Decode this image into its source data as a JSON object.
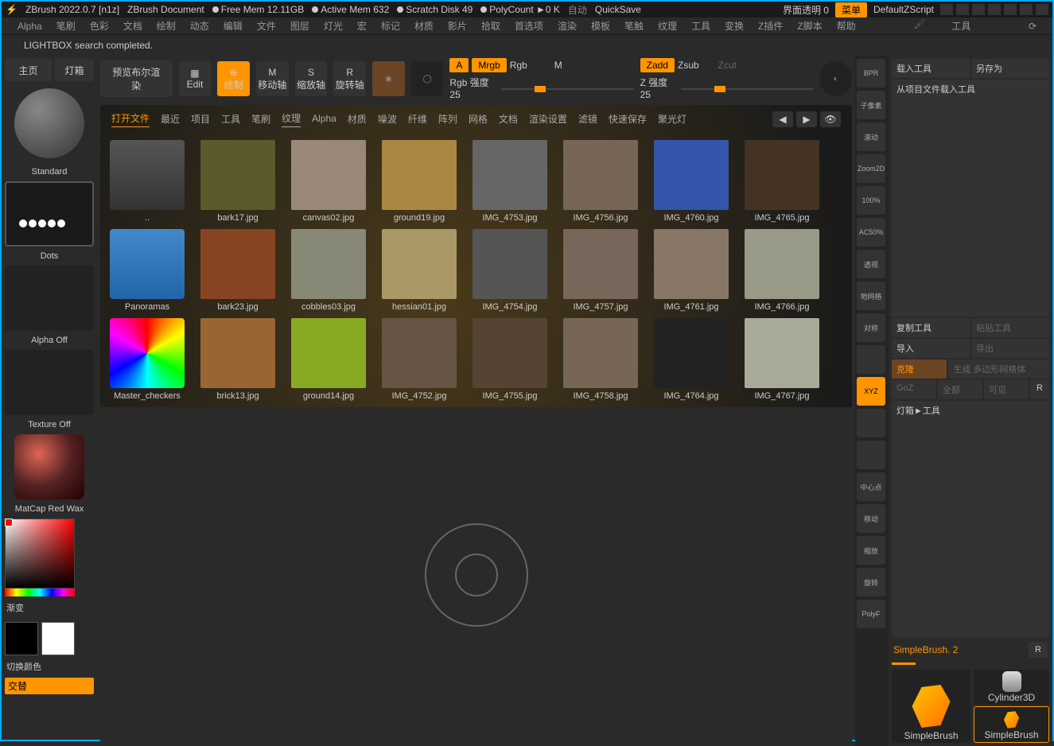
{
  "titlebar": {
    "app": "ZBrush 2022.0.7 [n1z]",
    "doc": "ZBrush Document",
    "mem": "Free Mem 12.11GB",
    "active": "Active Mem 632",
    "scratch": "Scratch Disk 49",
    "poly": "PolyCount ►0 K",
    "auto": "自动",
    "quicksave": "QuickSave",
    "transparency": "界面透明 0",
    "menu": "菜单",
    "script": "DefaultZScript"
  },
  "menu": [
    "Alpha",
    "笔刷",
    "色彩",
    "文档",
    "绘制",
    "动态",
    "编辑",
    "文件",
    "图层",
    "灯光",
    "宏",
    "标记",
    "材质",
    "影片",
    "拾取",
    "首选项",
    "渲染",
    "模板",
    "笔触",
    "纹理",
    "工具",
    "变换",
    "Z插件",
    "Z脚本",
    "帮助"
  ],
  "status": "LIGHTBOX search completed.",
  "left": {
    "home": "主页",
    "lightbox": "灯箱",
    "preview": "预览布尔渲染",
    "standard": "Standard",
    "dots": "Dots",
    "alpha": "Alpha Off",
    "texture": "Texture Off",
    "matcap": "MatCap Red Wax",
    "gradient": "渐变",
    "switch": "切换颜色",
    "alt": "交替"
  },
  "toolbar": {
    "edit": "Edit",
    "draw": "绘制",
    "move": "移动轴",
    "scale": "缩放轴",
    "rotate": "旋转轴",
    "a": "A",
    "mrgb": "Mrgb",
    "rgb": "Rgb",
    "m": "M",
    "zadd": "Zadd",
    "zsub": "Zsub",
    "zcut": "Zcut",
    "rgbint": "Rgb 强度 25",
    "zint": "Z 强度 25"
  },
  "lightbox": {
    "tabs": [
      "打开文件",
      "最近",
      "项目",
      "工具",
      "笔刷",
      "纹理",
      "Alpha",
      "材质",
      "噪波",
      "纤维",
      "阵列",
      "网格",
      "文档",
      "渲染设置",
      "滤镜",
      "快速保存",
      "聚光灯"
    ],
    "active": "纹理",
    "open_active": "打开文件",
    "items": [
      {
        "name": ".."
      },
      {
        "name": "bark17.jpg"
      },
      {
        "name": "canvas02.jpg"
      },
      {
        "name": "ground19.jpg"
      },
      {
        "name": "IMG_4753.jpg"
      },
      {
        "name": "IMG_4756.jpg"
      },
      {
        "name": "IMG_4760.jpg"
      },
      {
        "name": "IMG_4765.jpg"
      },
      {
        "name": "Panoramas"
      },
      {
        "name": "bark23.jpg"
      },
      {
        "name": "cobbles03.jpg"
      },
      {
        "name": "hessian01.jpg"
      },
      {
        "name": "IMG_4754.jpg"
      },
      {
        "name": "IMG_4757.jpg"
      },
      {
        "name": "IMG_4761.jpg"
      },
      {
        "name": "IMG_4766.jpg"
      },
      {
        "name": "Master_checkers"
      },
      {
        "name": "brick13.jpg"
      },
      {
        "name": "ground14.jpg"
      },
      {
        "name": "IMG_4752.jpg"
      },
      {
        "name": "IMG_4755.jpg"
      },
      {
        "name": "IMG_4758.jpg"
      },
      {
        "name": "IMG_4764.jpg"
      },
      {
        "name": "IMG_4767.jpg"
      }
    ]
  },
  "right_tools": [
    "BPR",
    "子像素",
    "滚动",
    "Zoom2D",
    "100%",
    "AC50%",
    "透视",
    "地网格",
    "对称",
    "",
    "XYZ",
    "",
    "",
    "中心点",
    "移动",
    "缩放",
    "旋转",
    "PolyF"
  ],
  "panel": {
    "title": "工具",
    "load": "载入工具",
    "saveas": "另存为",
    "loadproj": "从项目文件载入工具",
    "copy": "复制工具",
    "paste": "粘贴工具",
    "import": "导入",
    "export": "导出",
    "clone": "克隆",
    "genpoly": "生成 多边形网格体",
    "goz": "GoZ",
    "all": "全部",
    "visible": "可见",
    "r": "R",
    "lightboxtool": "灯箱►工具",
    "simplebrush": "SimpleBrush. 2",
    "r2": "R",
    "tool1": "SimpleBrush",
    "tool2": "Cylinder3D",
    "tool3": "SimpleBrush"
  }
}
